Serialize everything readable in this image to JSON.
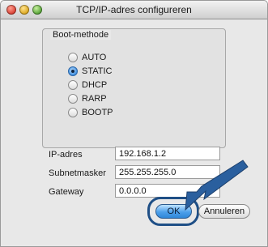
{
  "window": {
    "title": "TCP/IP-adres configureren"
  },
  "boot_method": {
    "legend": "Boot-methode",
    "options": [
      {
        "label": "AUTO",
        "selected": false
      },
      {
        "label": "STATIC",
        "selected": true
      },
      {
        "label": "DHCP",
        "selected": false
      },
      {
        "label": "RARP",
        "selected": false
      },
      {
        "label": "BOOTP",
        "selected": false
      }
    ]
  },
  "fields": {
    "ip_label": "IP-adres",
    "ip_value": "192.168.1.2",
    "subnet_label": "Subnetmasker",
    "subnet_value": "255.255.255.0",
    "gateway_label": "Gateway",
    "gateway_value": "0.0.0.0"
  },
  "buttons": {
    "ok_label": "OK",
    "cancel_label": "Annuleren"
  },
  "colors": {
    "accent": "#2f86d8",
    "arrow": "#2a5f9e"
  }
}
